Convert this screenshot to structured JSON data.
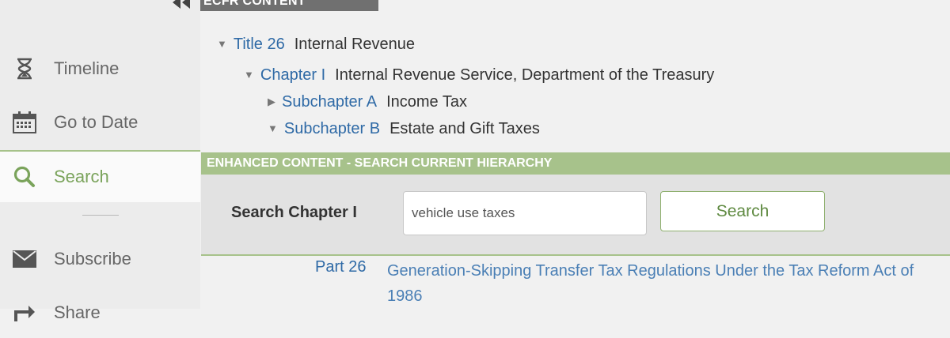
{
  "header": {
    "tab_label": "ECFR CONTENT"
  },
  "sidebar": {
    "items": [
      {
        "label": "Timeline",
        "icon": "hourglass-icon"
      },
      {
        "label": "Go to Date",
        "icon": "calendar-icon"
      },
      {
        "label": "Search",
        "icon": "search-icon",
        "active": true
      },
      {
        "label": "Subscribe",
        "icon": "envelope-icon"
      },
      {
        "label": "Share",
        "icon": "share-icon"
      }
    ],
    "active_color": "#7aa35b"
  },
  "hierarchy": {
    "title": {
      "link": "Title 26",
      "text": "Internal Revenue"
    },
    "chapter": {
      "link": "Chapter I",
      "text": "Internal Revenue Service, Department of the Treasury"
    },
    "subchapters": [
      {
        "link": "Subchapter A",
        "text": "Income Tax",
        "expanded": false
      },
      {
        "link": "Subchapter B",
        "text": "Estate and Gift Taxes",
        "expanded": true
      }
    ]
  },
  "enhanced": {
    "bar_label": "ENHANCED CONTENT - SEARCH CURRENT HIERARCHY",
    "search_label": "Search Chapter I",
    "search_value": "vehicle use taxes",
    "search_button": "Search"
  },
  "result": {
    "part_label": "Part 26",
    "part_text": "Generation-Skipping Transfer Tax Regulations Under the Tax Reform Act of 1986"
  },
  "colors": {
    "link": "#2f6aa6",
    "accent_green": "#a7c28b"
  }
}
